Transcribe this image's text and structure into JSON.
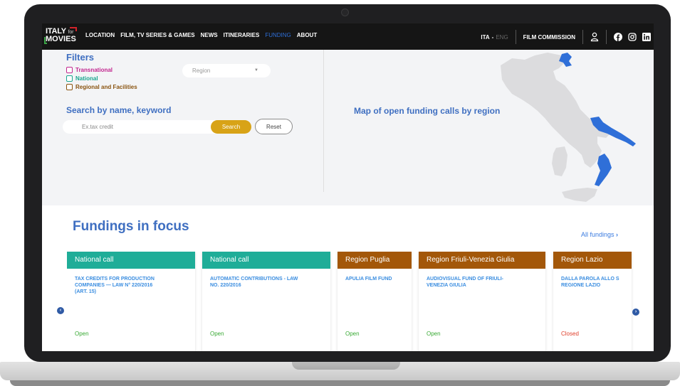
{
  "logo": {
    "line1": "ITALY",
    "for": "for",
    "line2": "MOVIES"
  },
  "nav": {
    "links": [
      "LOCATION",
      "FILM, TV SERIES & GAMES",
      "NEWS",
      "ITINERARIES",
      "FUNDING",
      "ABOUT"
    ],
    "active": "FUNDING",
    "lang_ita": "ITA",
    "lang_sep": "-",
    "lang_eng": "ENG",
    "film_commission": "FILM COMMISSION"
  },
  "filters": {
    "title": "Filters",
    "checkboxes": [
      {
        "label": "Transnational",
        "color": "#c2268f"
      },
      {
        "label": "National",
        "color": "#1aa58e"
      },
      {
        "label": "Regional and Facilities",
        "color": "#8a5410"
      }
    ],
    "region_placeholder": "Region",
    "search_title": "Search by name, keyword",
    "search_placeholder": "Ex.tax credit",
    "search_button": "Search",
    "reset_button": "Reset"
  },
  "map": {
    "title": "Map of open funding calls by region",
    "highlight_color": "#2f6fd8"
  },
  "fundings": {
    "title": "Fundings in focus",
    "all_link": "All fundings",
    "cards": [
      {
        "header": "National call",
        "header_color": "#1fad98",
        "title": "TAX CREDITS FOR PRODUCTION\nCOMPANIES — LAW N° 220/2016\n(ART. 15)",
        "status": "Open",
        "status_color": "#3aaa35"
      },
      {
        "header": "National call",
        "header_color": "#1fad98",
        "title": "AUTOMATIC CONTRIBUTIONS - LAW\nNO. 220/2016",
        "status": "Open",
        "status_color": "#3aaa35"
      },
      {
        "header": "Region Puglia",
        "header_color": "#a35709",
        "title": "APULIA FILM FUND",
        "status": "Open",
        "status_color": "#3aaa35"
      },
      {
        "header": "Region Friuli-Venezia Giulia",
        "header_color": "#a35709",
        "title": "AUDIOVISUAL FUND OF FRIULI-\nVENEZIA GIULIA",
        "status": "Open",
        "status_color": "#3aaa35"
      },
      {
        "header": "Region Lazio",
        "header_color": "#a35709",
        "title": "DALLA PAROLA ALLO S\nREGIONE LAZIO",
        "status": "Closed",
        "status_color": "#e0402c"
      }
    ]
  }
}
